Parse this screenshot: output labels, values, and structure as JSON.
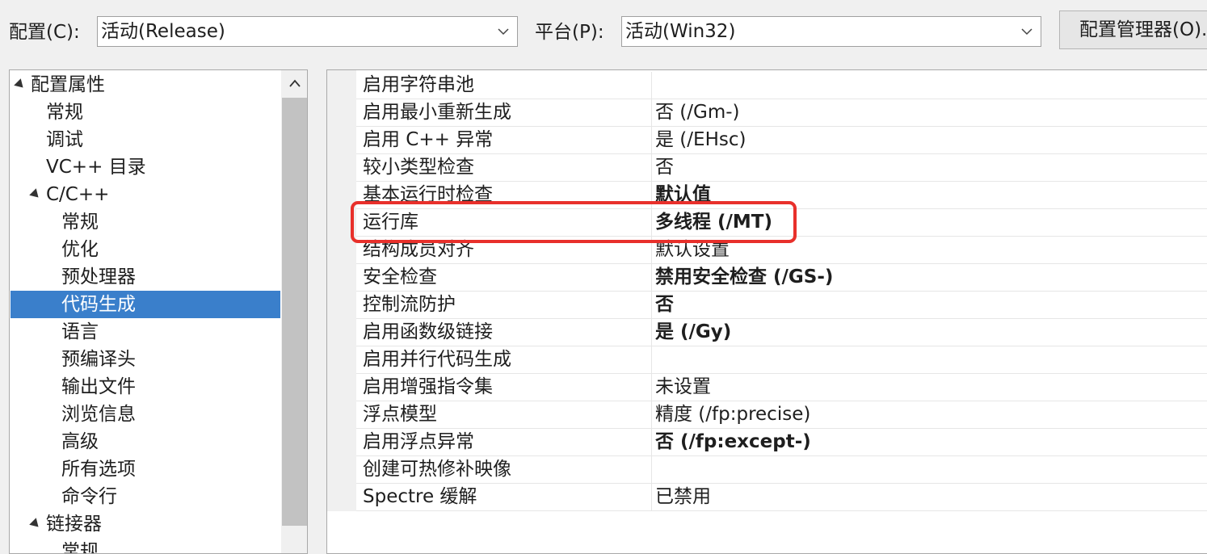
{
  "toolbar": {
    "config_label": "配置(C):",
    "config_value": "活动(Release)",
    "platform_label": "平台(P):",
    "platform_value": "活动(Win32)",
    "manager_button": "配置管理器(O)..."
  },
  "tree": {
    "items": [
      {
        "label": "配置属性",
        "level": 0,
        "expanded": true
      },
      {
        "label": "常规",
        "level": 1
      },
      {
        "label": "调试",
        "level": 1
      },
      {
        "label": "VC++ 目录",
        "level": 1
      },
      {
        "label": "C/C++",
        "level": 1,
        "expanded": true
      },
      {
        "label": "常规",
        "level": 2
      },
      {
        "label": "优化",
        "level": 2
      },
      {
        "label": "预处理器",
        "level": 2
      },
      {
        "label": "代码生成",
        "level": 2,
        "selected": true
      },
      {
        "label": "语言",
        "level": 2
      },
      {
        "label": "预编译头",
        "level": 2
      },
      {
        "label": "输出文件",
        "level": 2
      },
      {
        "label": "浏览信息",
        "level": 2
      },
      {
        "label": "高级",
        "level": 2
      },
      {
        "label": "所有选项",
        "level": 2
      },
      {
        "label": "命令行",
        "level": 2
      },
      {
        "label": "链接器",
        "level": 1,
        "expanded": true
      },
      {
        "label": "常规",
        "level": 2
      }
    ]
  },
  "grid": {
    "rows": [
      {
        "name": "启用字符串池",
        "value": "",
        "bold": false
      },
      {
        "name": "启用最小重新生成",
        "value": "否 (/Gm-)",
        "bold": false
      },
      {
        "name": "启用 C++ 异常",
        "value": "是 (/EHsc)",
        "bold": false
      },
      {
        "name": "较小类型检查",
        "value": "否",
        "bold": false
      },
      {
        "name": "基本运行时检查",
        "value": "默认值",
        "bold": true
      },
      {
        "name": "运行库",
        "value": "多线程 (/MT)",
        "bold": true
      },
      {
        "name": "结构成员对齐",
        "value": "默认设置",
        "bold": false
      },
      {
        "name": "安全检查",
        "value": "禁用安全检查 (/GS-)",
        "bold": true
      },
      {
        "name": "控制流防护",
        "value": "否",
        "bold": true
      },
      {
        "name": "启用函数级链接",
        "value": "是 (/Gy)",
        "bold": true
      },
      {
        "name": "启用并行代码生成",
        "value": "",
        "bold": false
      },
      {
        "name": "启用增强指令集",
        "value": "未设置",
        "bold": false
      },
      {
        "name": "浮点模型",
        "value": "精度 (/fp:precise)",
        "bold": false
      },
      {
        "name": "启用浮点异常",
        "value": "否 (/fp:except-)",
        "bold": true
      },
      {
        "name": "创建可热修补映像",
        "value": "",
        "bold": false
      },
      {
        "name": "Spectre 缓解",
        "value": "已禁用",
        "bold": false
      }
    ]
  },
  "colors": {
    "selection": "#3a7fcb",
    "highlight_box": "#e8302b"
  }
}
